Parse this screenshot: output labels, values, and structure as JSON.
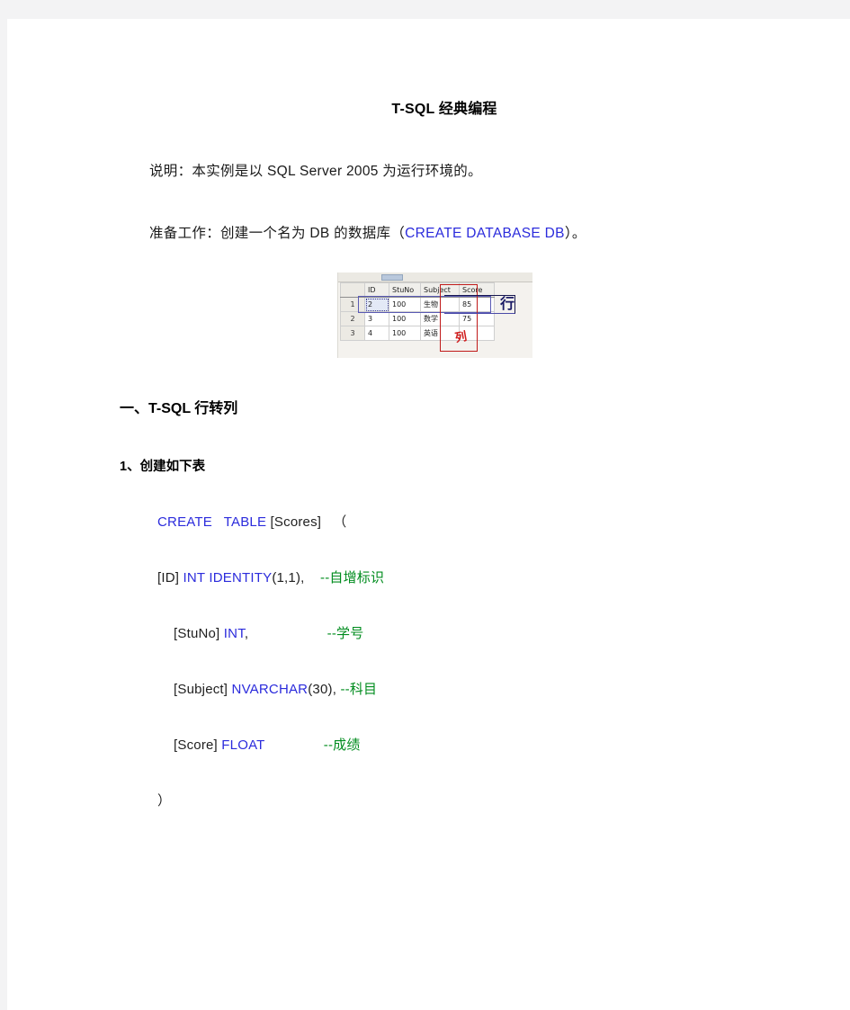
{
  "document": {
    "title": "T-SQL  经典编程",
    "intro_paragraphs": [
      {
        "id": "note",
        "text_before": "说明：本实例是以 SQL Server 2005  为运行环境的。"
      },
      {
        "id": "prep",
        "text_before": "准备工作：创建一个名为 DB  的数据库（",
        "code": "CREATE DATABASE  DB",
        "text_after": "）。"
      }
    ],
    "figure": {
      "name": "query-result-grid",
      "columns": [
        "",
        "ID",
        "StuNo",
        "Subject",
        "Score"
      ],
      "rows": [
        {
          "num": "1",
          "id": "2",
          "stuno": "100",
          "subject": "生物",
          "score": "85"
        },
        {
          "num": "2",
          "id": "3",
          "stuno": "100",
          "subject": "数学",
          "score": "75"
        },
        {
          "num": "3",
          "id": "4",
          "stuno": "100",
          "subject": "英语",
          "score": ""
        }
      ],
      "annotations": {
        "row_label": "行",
        "row_label_color": "#1c1c66",
        "column_label": "列",
        "column_label_color": "#d01b1b"
      }
    },
    "section_heading": "一、T-SQL  行转列",
    "sub_heading": "1、创建如下表",
    "code_block": [
      {
        "indent": 0,
        "segments": [
          {
            "text": "CREATE   TABLE ",
            "color": "blue"
          },
          {
            "text": "[Scores]   （",
            "color": "dark"
          }
        ]
      },
      {
        "indent": 0,
        "segments": [
          {
            "text": "[ID] ",
            "color": "dark"
          },
          {
            "text": "INT IDENTITY",
            "color": "blue"
          },
          {
            "text": "(1,1),",
            "color": "dark"
          },
          {
            "text": "    --自增标识",
            "color": "green"
          }
        ]
      },
      {
        "indent": 1,
        "segments": [
          {
            "text": "[StuNo] ",
            "color": "dark"
          },
          {
            "text": "INT",
            "color": "blue"
          },
          {
            "text": ",",
            "color": "dark"
          },
          {
            "text": "                    --学号",
            "color": "green"
          }
        ]
      },
      {
        "indent": 1,
        "segments": [
          {
            "text": "[Subject] ",
            "color": "dark"
          },
          {
            "text": "NVARCHAR",
            "color": "blue"
          },
          {
            "text": "(30), ",
            "color": "dark"
          },
          {
            "text": "--科目",
            "color": "green"
          }
        ]
      },
      {
        "indent": 1,
        "segments": [
          {
            "text": "[Score] ",
            "color": "dark"
          },
          {
            "text": "FLOAT",
            "color": "blue"
          },
          {
            "text": "               --成绩",
            "color": "green"
          }
        ]
      },
      {
        "indent": 0,
        "segments": [
          {
            "text": "）",
            "color": "dark"
          }
        ]
      }
    ],
    "colors": {
      "keyword_blue": "#2b2bdc",
      "comment_green": "#008c1e",
      "text_dark": "#1f1f1f",
      "page_background": "#ffffff",
      "gutter_background": "#f3f3f4"
    }
  }
}
